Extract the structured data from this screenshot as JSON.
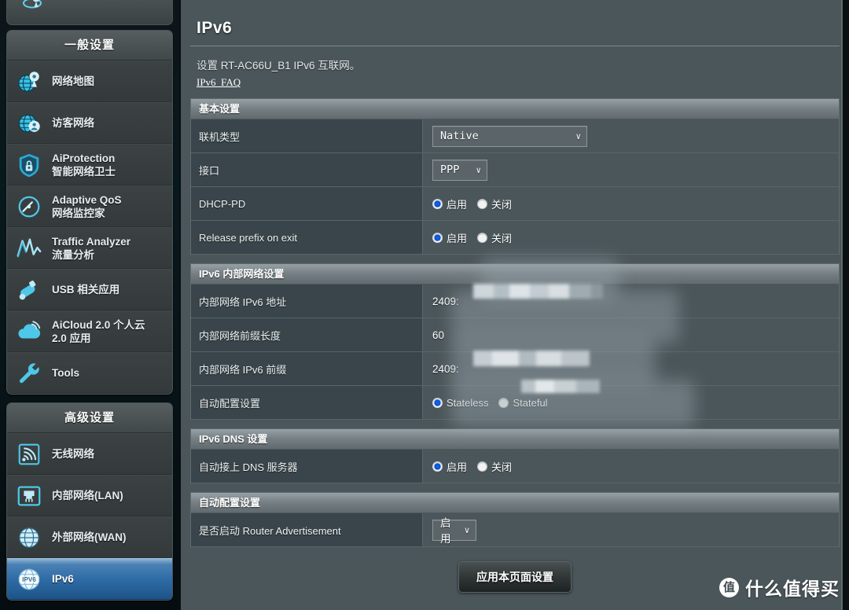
{
  "sidebar": {
    "groups": [
      {
        "header": "一般设置",
        "items": [
          {
            "label": "网络地图",
            "icon": "globe-pin-icon",
            "selected": false
          },
          {
            "label": "访客网络",
            "icon": "globe-users-icon",
            "selected": false
          },
          {
            "label": "AiProtection",
            "label2": "智能网络卫士",
            "icon": "shield-lock-icon",
            "selected": false
          },
          {
            "label": "Adaptive QoS",
            "label2": "网络监控家",
            "icon": "speedometer-icon",
            "selected": false
          },
          {
            "label": "Traffic Analyzer",
            "label2": "流量分析",
            "icon": "waveform-icon",
            "selected": false
          },
          {
            "label": "USB 相关应用",
            "icon": "usb-icon",
            "selected": false
          },
          {
            "label": "AiCloud 2.0 个人云",
            "label2": "2.0 应用",
            "icon": "cloud-icon",
            "selected": false
          },
          {
            "label": "Tools",
            "icon": "wrench-icon",
            "selected": false
          }
        ]
      },
      {
        "header": "高级设置",
        "items": [
          {
            "label": "无线网络",
            "icon": "wireless-icon",
            "selected": false
          },
          {
            "label": "内部网络(LAN)",
            "icon": "lan-port-icon",
            "selected": false
          },
          {
            "label": "外部网络(WAN)",
            "icon": "globe-icon",
            "selected": false
          },
          {
            "label": "IPv6",
            "icon": "ipv6-globe-icon",
            "selected": true
          }
        ]
      }
    ]
  },
  "main": {
    "page_title": "IPv6",
    "description": "设置 RT-AC66U_B1 IPv6 互联网。",
    "faq_link": "IPv6_FAQ",
    "sections": [
      {
        "header": "基本设置",
        "rows": [
          {
            "label": "联机类型",
            "control": "select",
            "value": "Native",
            "width": "wide"
          },
          {
            "label": "接口",
            "control": "select",
            "value": "PPP",
            "width": "mid"
          },
          {
            "label": "DHCP-PD",
            "control": "radio",
            "options": [
              "启用",
              "关闭"
            ],
            "selected": 0
          },
          {
            "label": "Release prefix on exit",
            "control": "radio",
            "options": [
              "启用",
              "关闭"
            ],
            "selected": 0
          }
        ]
      },
      {
        "header": "IPv6 内部网络设置",
        "rows": [
          {
            "label": "内部网络 IPv6 地址",
            "control": "text",
            "value": "2409:",
            "redacted": true
          },
          {
            "label": "内部网络前缀长度",
            "control": "text",
            "value": "60",
            "redacted": false
          },
          {
            "label": "内部网络 IPv6 前缀",
            "control": "text",
            "value": "2409:",
            "redacted": true
          },
          {
            "label": "自动配置设置",
            "control": "radio",
            "options": [
              "Stateless",
              "Stateful"
            ],
            "selected": 0,
            "redacted": true
          }
        ]
      },
      {
        "header": "IPv6 DNS 设置",
        "rows": [
          {
            "label": "自动接上 DNS 服务器",
            "control": "radio",
            "options": [
              "启用",
              "关闭"
            ],
            "selected": 0
          }
        ]
      },
      {
        "header": "自动配置设置",
        "rows": [
          {
            "label": "是否启动 Router Advertisement",
            "control": "select",
            "value": "启用",
            "width": "sm",
            "cn": true
          }
        ]
      }
    ],
    "apply_button": "应用本页面设置"
  },
  "watermark": {
    "badge": "值",
    "text": "什么值得买"
  },
  "colors": {
    "accent_blue": "#0b4fd2",
    "sidebar_selected": "#2f6ca6",
    "panel_bg": "#4b565a",
    "label_bg": "#39454a",
    "section_header": "#768084"
  }
}
